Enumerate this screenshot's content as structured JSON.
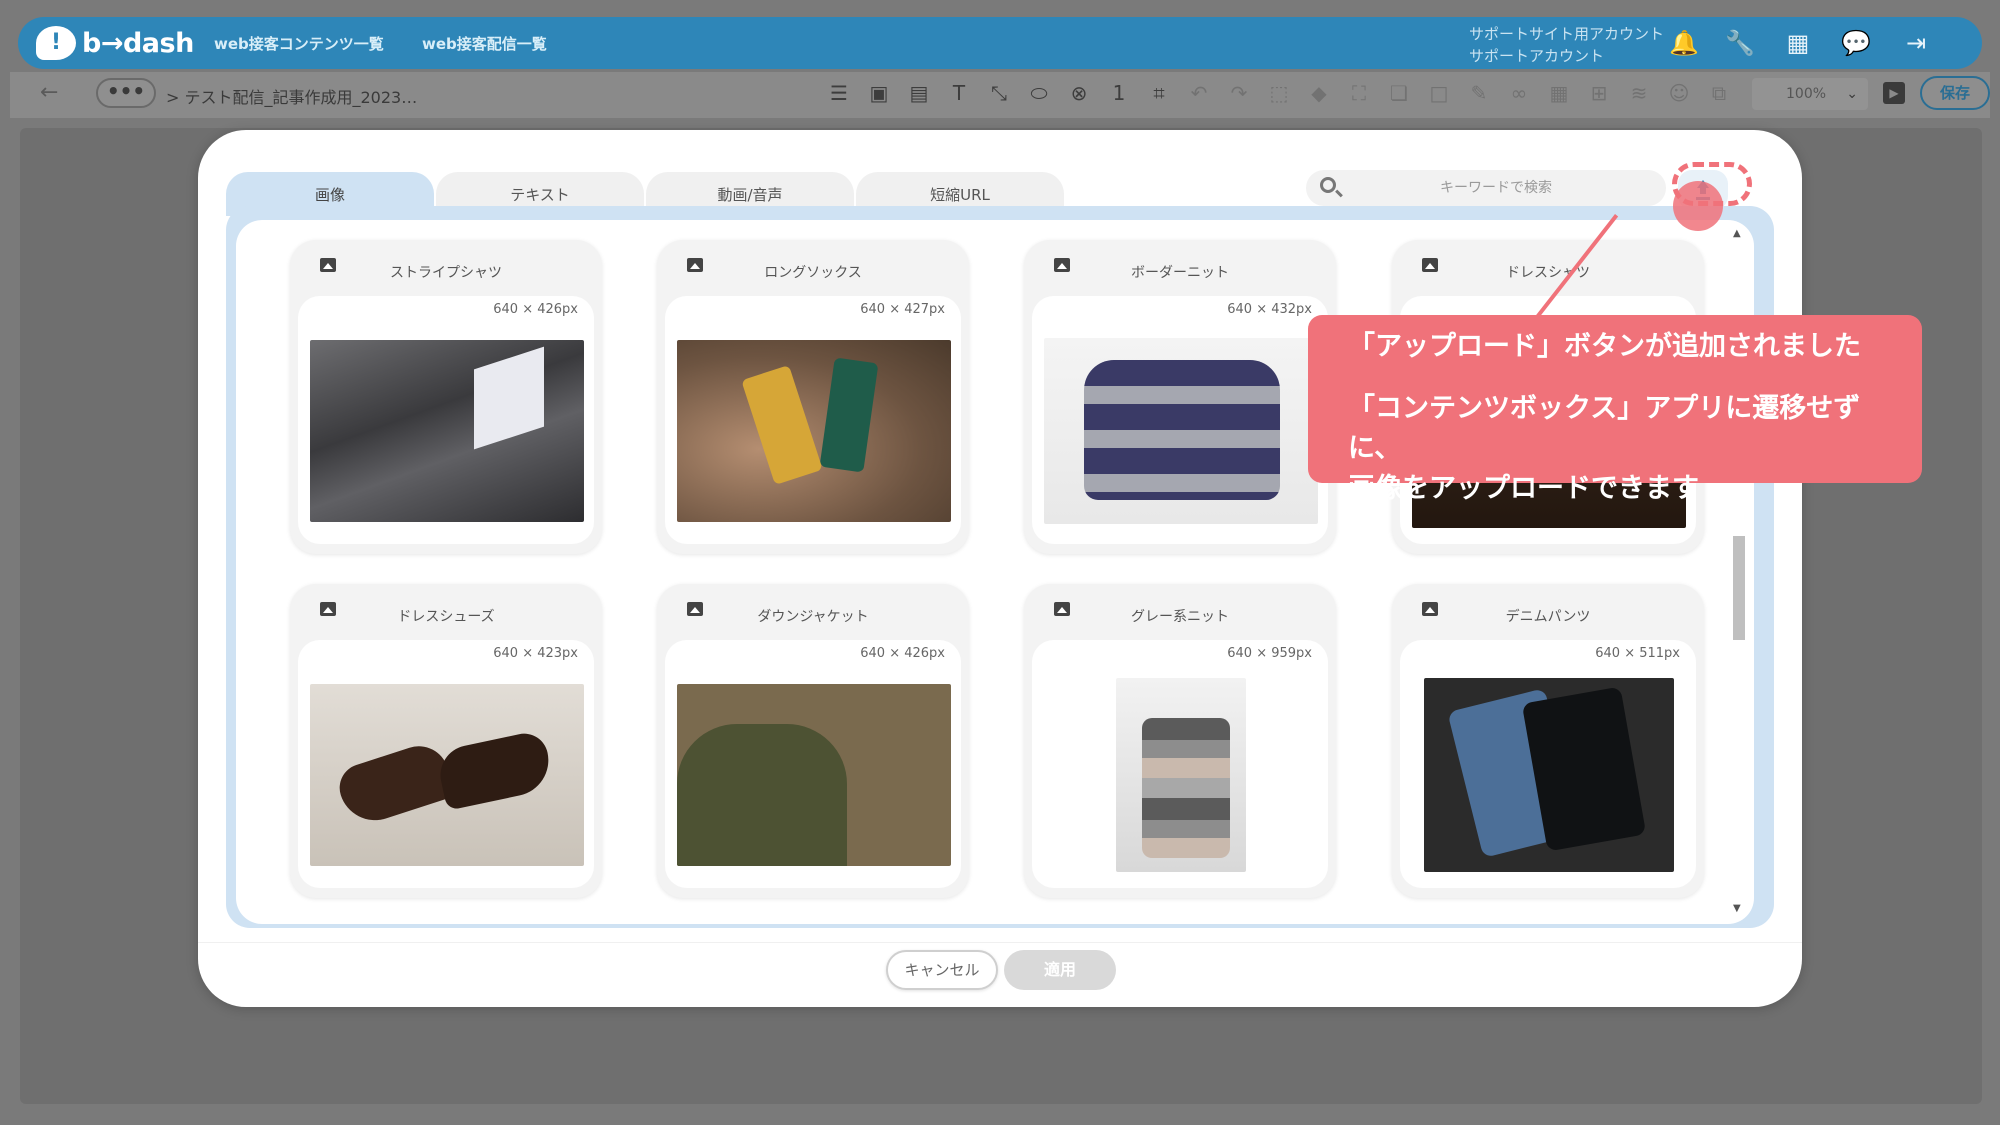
{
  "header": {
    "logo_text": "b→dash",
    "nav": [
      "web接客コンテンツ一覧",
      "web接客配信一覧"
    ],
    "account_line1": "サポートサイト用アカウント",
    "account_line2": "サポートアカウント",
    "icons": [
      "bell-icon",
      "wrench-icon",
      "apps-grid-icon",
      "notifications-bubble-icon",
      "logout-icon"
    ]
  },
  "toolbar": {
    "back_icon": "←",
    "more_label": "•••",
    "breadcrumb": "> テスト配信_記事作成用_2023…",
    "zoom": "100%",
    "save_label": "保存",
    "layer_number": "1"
  },
  "modal": {
    "tabs": [
      "画像",
      "テキスト",
      "動画/音声",
      "短縮URL"
    ],
    "active_tab": "画像",
    "search_placeholder": "キーワードで検索",
    "cancel_label": "キャンセル",
    "apply_label": "適用",
    "items": [
      {
        "title": "ストライプシャツ",
        "dims": "640 × 426px",
        "photo": "shirt"
      },
      {
        "title": "ロングソックス",
        "dims": "640 × 427px",
        "photo": "socks"
      },
      {
        "title": "ボーダーニット",
        "dims": "640 × 432px",
        "photo": "knit"
      },
      {
        "title": "ドレスシャツ",
        "dims": "",
        "photo": "dress"
      },
      {
        "title": "ドレスシューズ",
        "dims": "640 × 423px",
        "photo": "shoes"
      },
      {
        "title": "ダウンジャケット",
        "dims": "640 × 426px",
        "photo": "jacket"
      },
      {
        "title": "グレー系ニット",
        "dims": "640 × 959px",
        "photo": "grey"
      },
      {
        "title": "デニムパンツ",
        "dims": "640 × 511px",
        "photo": "jeans"
      }
    ]
  },
  "callout": {
    "line1": "「アップロード」ボタンが追加されました",
    "line2a": "「コンテンツボックス」アプリに遷移せずに、",
    "line2b": "画像をアップロードできます"
  },
  "colors": {
    "brand": "#2e86b8",
    "active_tab": "#cfe2f3",
    "callout": "#f0727a"
  }
}
